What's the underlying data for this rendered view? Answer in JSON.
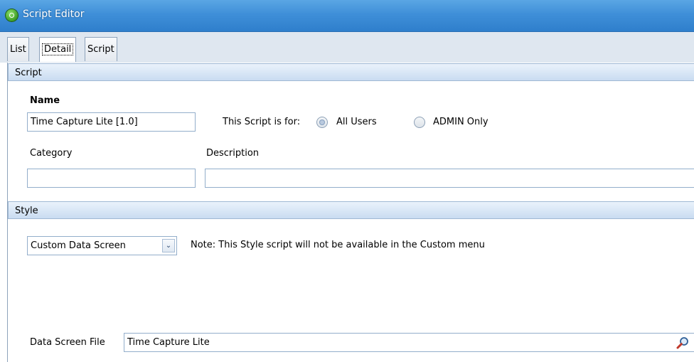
{
  "window": {
    "title": "Script Editor",
    "icon": "app-logo-icon"
  },
  "tabs": [
    {
      "label": "List",
      "active": false
    },
    {
      "label": "Detail",
      "active": true
    },
    {
      "label": "Script",
      "active": false
    }
  ],
  "script_section": {
    "header": "Script",
    "name_label": "Name",
    "name_value": "Time Capture Lite [1.0]",
    "for_label": "This Script is for:",
    "radio_options": [
      {
        "label": "All Users",
        "selected": true
      },
      {
        "label": "ADMIN Only",
        "selected": false
      }
    ],
    "category_label": "Category",
    "category_value": "",
    "description_label": "Description",
    "description_value": ""
  },
  "style_section": {
    "header": "Style",
    "style_value": "Custom Data Screen",
    "note": "Note: This Style script will not be available in the Custom menu",
    "data_screen_label": "Data Screen File",
    "data_screen_value": "Time Capture Lite"
  },
  "icons": {
    "dropdown": "chevron-down-icon",
    "lookup": "magnifier-search-icon"
  },
  "colors": {
    "titlebar": "#3f8fd8",
    "section_header": "#c9dcf1",
    "border": "#93aecb"
  }
}
